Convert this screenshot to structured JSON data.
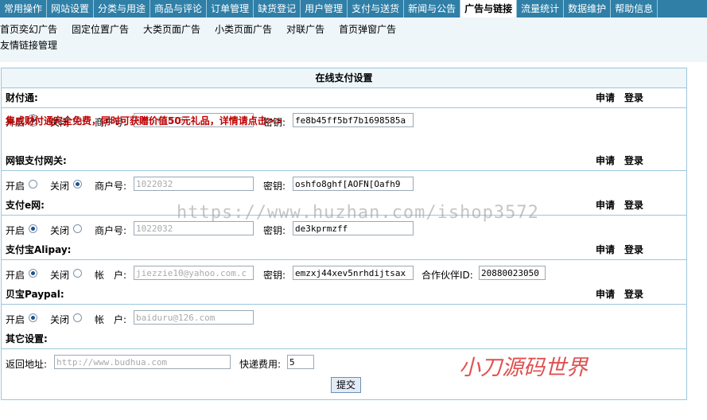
{
  "nav": {
    "tabs": [
      "常用操作",
      "网站设置",
      "分类与用途",
      "商品与评论",
      "订单管理",
      "缺货登记",
      "用户管理",
      "支付与送货",
      "新闻与公告",
      "广告与链接",
      "流量统计",
      "数据维护",
      "帮助信息"
    ],
    "active_index": 9
  },
  "subnav": {
    "items": [
      "首页奕幻广告",
      "固定位置广告",
      "大类页面广告",
      "小类页面广告",
      "对联广告",
      "首页弹窗广告"
    ],
    "second_line": "友情链接管理"
  },
  "panel": {
    "title": "在线支付设置",
    "apply_label": "申请",
    "login_label": "登录",
    "on_label": "开启",
    "off_label": "关闭",
    "merchant_label": "商户号:",
    "key_label": "密钥:",
    "account_label": "帐　户:",
    "partner_label": "合作伙伴ID:"
  },
  "tenpay": {
    "name": "财付通:",
    "enabled": true,
    "merchant": "1202018701",
    "key": "fe8b45ff5bf7b1698585a",
    "promo": "集成财付通完全免费，同时可获赠价值50元礼品，详情请点击>>"
  },
  "chinabank": {
    "name": "网银支付网关:",
    "enabled": false,
    "merchant": "1022032",
    "key": "oshfo8ghf[AOFN[Oafh9"
  },
  "epay": {
    "name": "支付e网:",
    "enabled": true,
    "merchant": "1022032",
    "key": "de3kprmzff"
  },
  "alipay": {
    "name": "支付宝Alipay:",
    "enabled": true,
    "account": "jiezzie10@yahoo.com.c",
    "key": "emzxj44xev5nrhdijtsax",
    "partner_id": "20880023050"
  },
  "paypal": {
    "name": "贝宝Paypal:",
    "enabled": true,
    "account": "baiduru@126.com"
  },
  "other": {
    "name": "其它设置:",
    "return_label": "返回地址:",
    "return_url": "http://www.budhua.com",
    "shipping_label": "快递费用:",
    "shipping_fee": "5"
  },
  "submit_label": "提交",
  "watermark": "https://www.huzhan.com/ishop3572",
  "brand_text": "小刀源码世界"
}
